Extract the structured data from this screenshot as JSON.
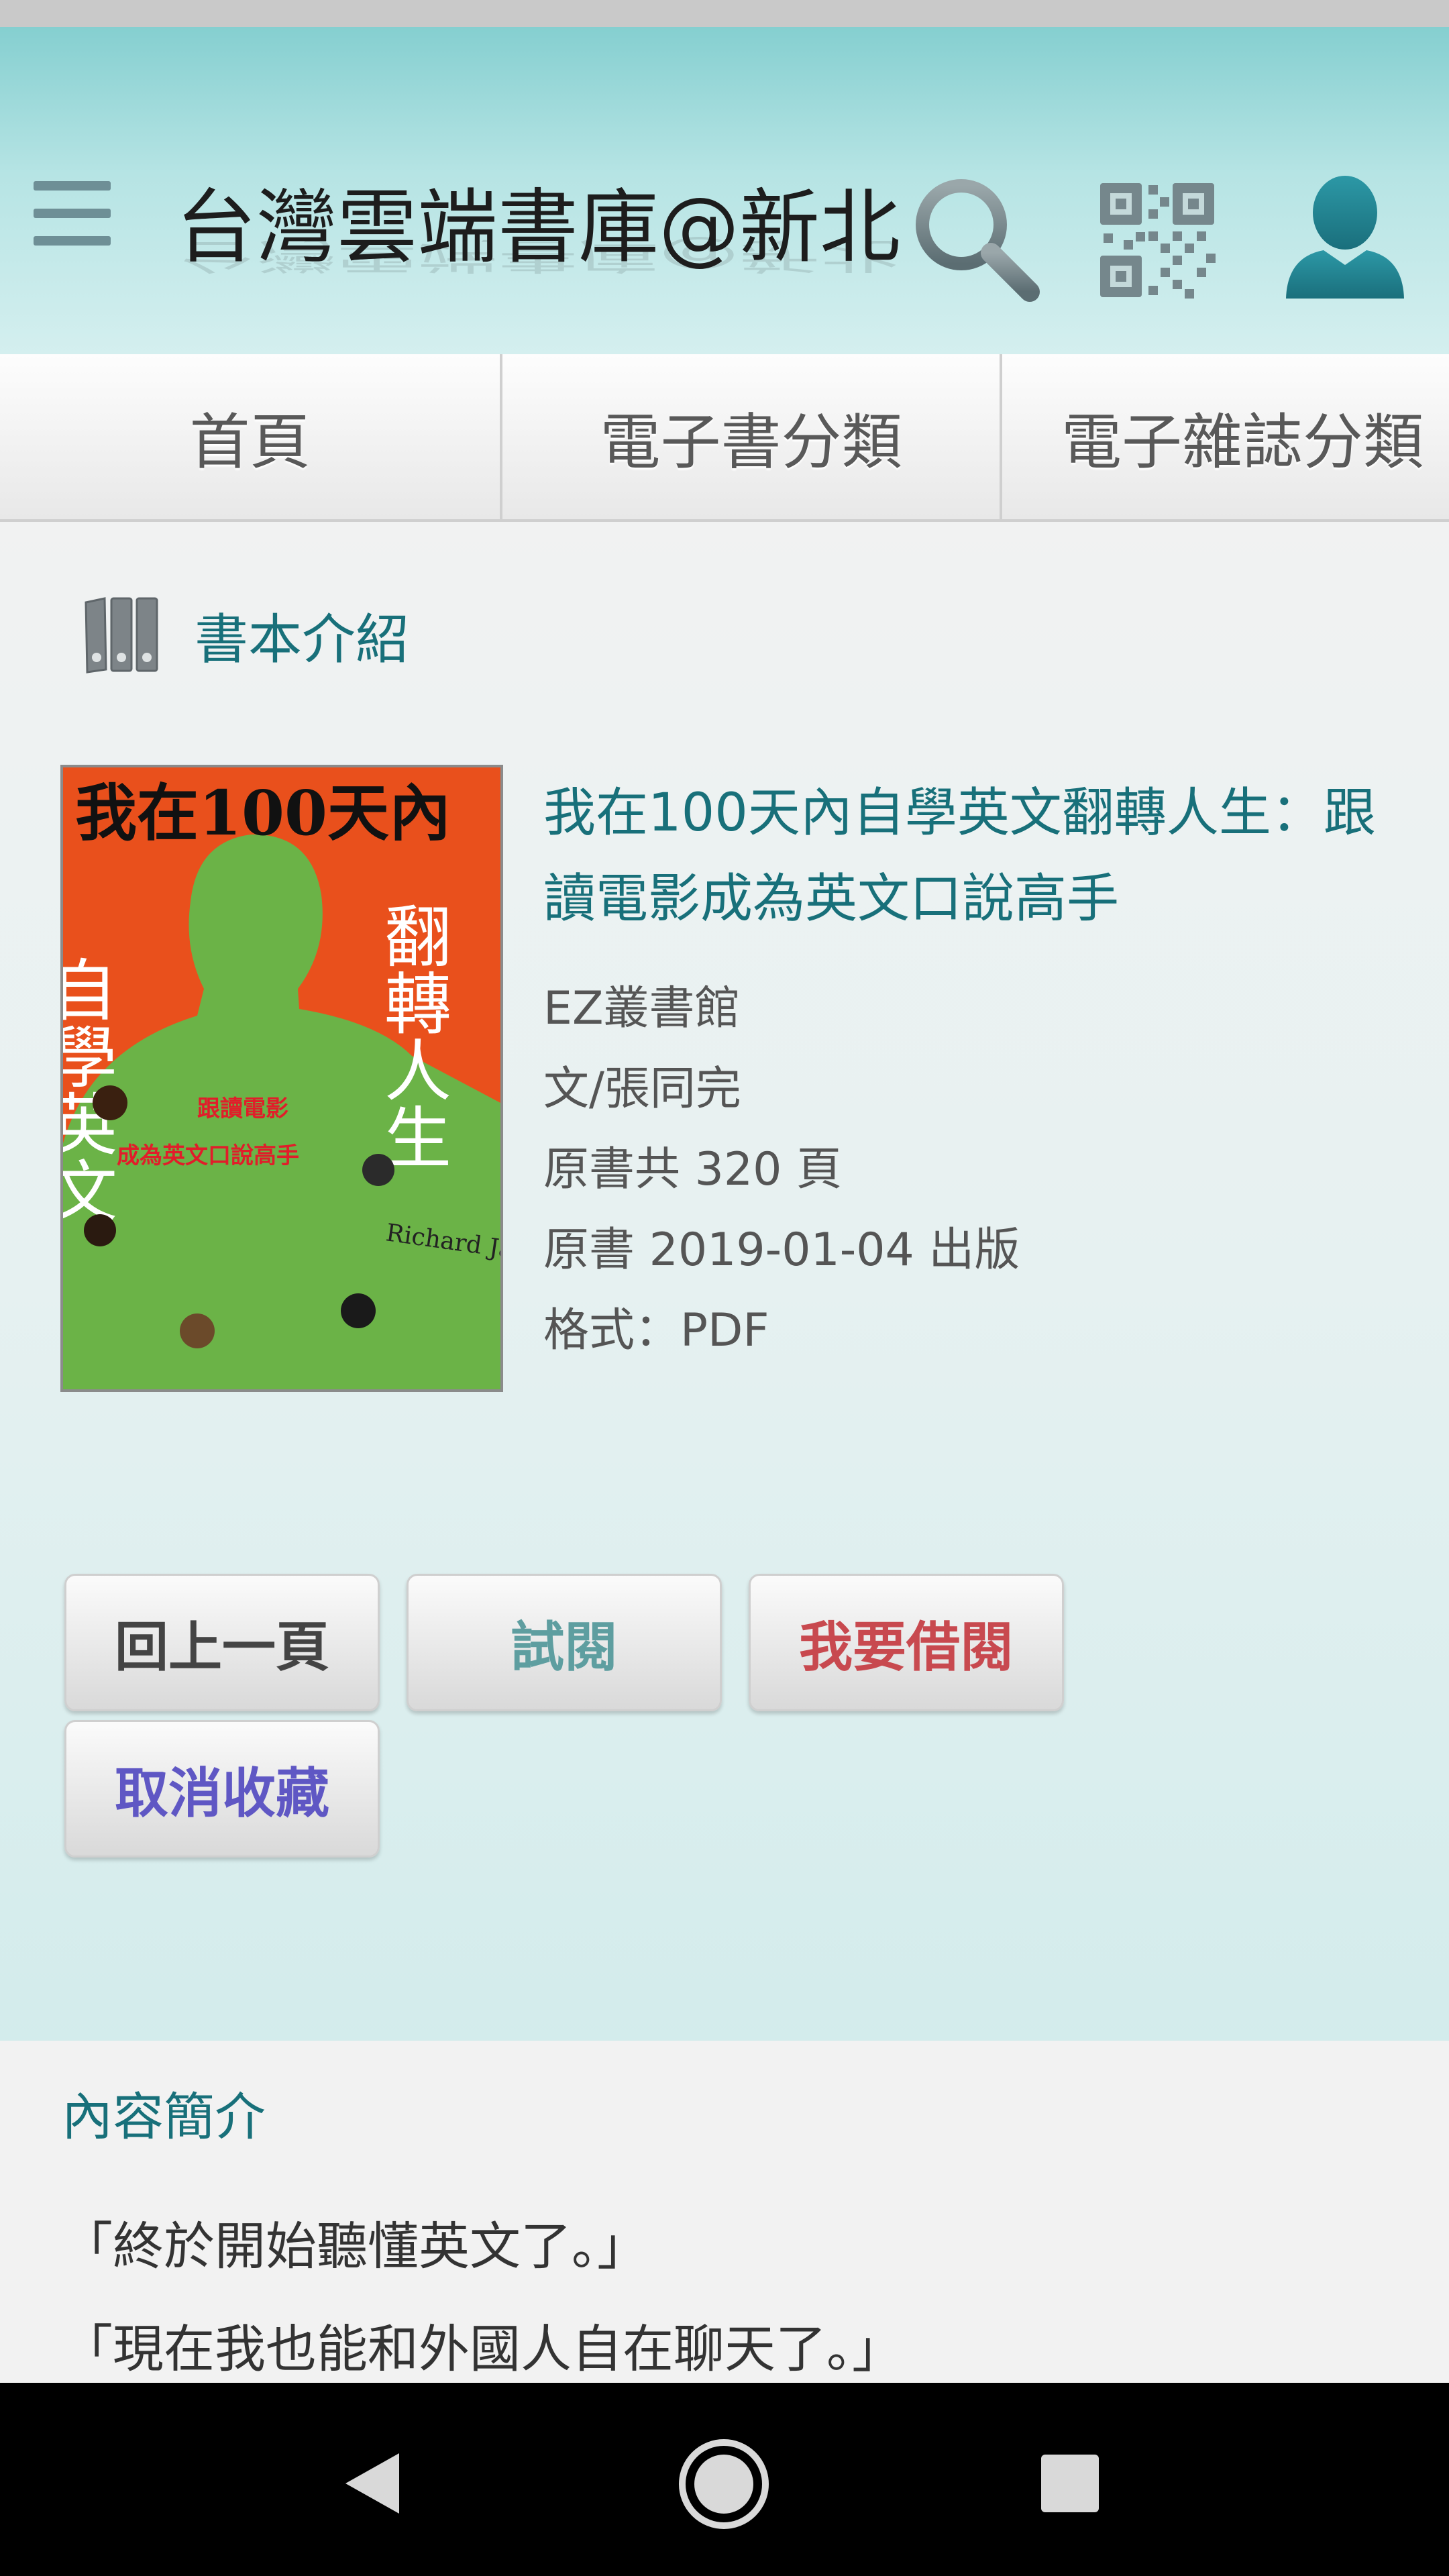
{
  "header": {
    "title": "台灣雲端書庫@新北",
    "icons": [
      "menu-icon",
      "search-icon",
      "qr-code-icon",
      "user-icon"
    ]
  },
  "tabs": [
    "首頁",
    "電子書分類",
    "電子雜誌分類"
  ],
  "section": {
    "title": "書本介紹"
  },
  "book": {
    "title": "我在100天內自學英文翻轉人生：跟讀電影成為英文口說高手",
    "series": "EZ叢書館",
    "author": "文/張同完",
    "pages": "原書共 320 頁",
    "published": "原書 2019-01-04 出版",
    "format": "格式：PDF",
    "cover": {
      "top": "我在100天內",
      "left": "自學英文",
      "right": "翻轉人生",
      "subtitle_1": "跟讀電影",
      "subtitle_2": "成為英文口說高手",
      "author": "Richard Jang",
      "colors": {
        "background": "#e9501c",
        "silhouette": "#6bb347"
      }
    }
  },
  "buttons": {
    "back": "回上一頁",
    "preview": "試閱",
    "borrow": "我要借閱",
    "unfavorite": "取消收藏"
  },
  "summary": {
    "title": "內容簡介",
    "lines": [
      "「終於開始聽懂英文了。」",
      "「現在我也能和外國人自在聊天了。」"
    ]
  },
  "colors": {
    "accent": "#18707a",
    "header_gradient_top": "#85cfd0",
    "borrow": "#c8494f",
    "unfavorite": "#5f57c4",
    "preview": "#5e9ea0"
  }
}
